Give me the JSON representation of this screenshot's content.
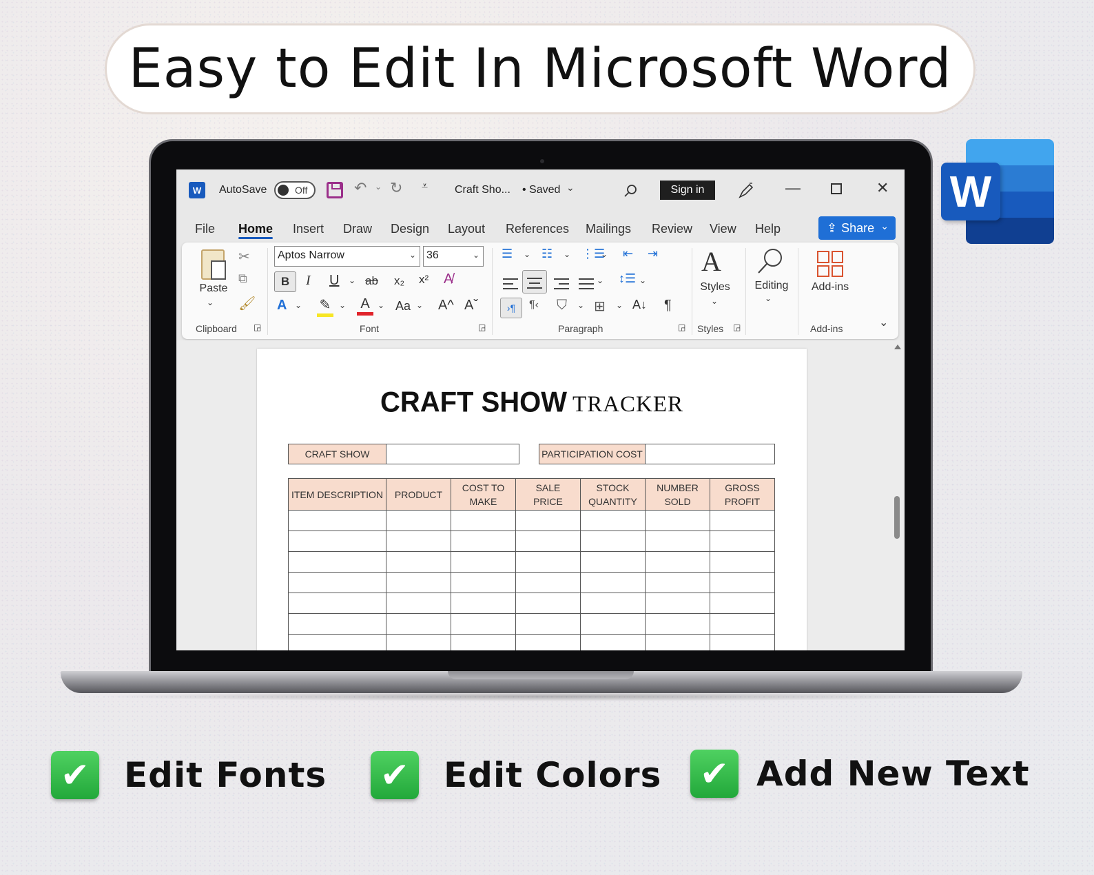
{
  "headline": "Easy to Edit In Microsoft Word",
  "word_logo_letter": "W",
  "titlebar": {
    "app_icon": "W",
    "autosave_label": "AutoSave",
    "toggle_state": "Off",
    "doc_title": "Craft Sho...",
    "saved_status": "• Saved",
    "sign_in": "Sign in"
  },
  "menu": {
    "items": [
      "File",
      "Home",
      "Insert",
      "Draw",
      "Design",
      "Layout",
      "References",
      "Mailings",
      "Review",
      "View",
      "Help"
    ],
    "active": "Home",
    "share_label": "Share"
  },
  "ribbon": {
    "paste_label": "Paste",
    "font_name": "Aptos Narrow",
    "font_size": "36",
    "bold": "B",
    "italic": "I",
    "underline": "U",
    "strike": "ab",
    "subscript": "x₂",
    "superscript": "x²",
    "change_case": "Aa",
    "grow_font": "A^",
    "shrink_font": "Aˇ",
    "styles_label": "Styles",
    "editing_label": "Editing",
    "addins_label": "Add-ins",
    "groups": {
      "clipboard": "Clipboard",
      "font": "Font",
      "paragraph": "Paragraph",
      "styles": "Styles",
      "addins": "Add-ins"
    }
  },
  "document": {
    "title_bold": "CRAFT SHOW",
    "title_serif": "TRACKER",
    "craft_show_label": "CRAFT SHOW",
    "participation_cost_label": "PARTICIPATION COST",
    "columns": [
      [
        "ITEM DESCRIPTION"
      ],
      [
        "PRODUCT"
      ],
      [
        "COST TO",
        "MAKE"
      ],
      [
        "SALE",
        "PRICE"
      ],
      [
        "STOCK",
        "QUANTITY"
      ],
      [
        "NUMBER",
        "SOLD"
      ],
      [
        "GROSS",
        "PROFIT"
      ]
    ]
  },
  "features": [
    "Edit Fonts",
    "Edit Colors",
    "Add New Text"
  ],
  "colors": {
    "header_fill": "#f8dccd",
    "accent_blue": "#1f6fd6",
    "check_green": "#22a83a"
  }
}
